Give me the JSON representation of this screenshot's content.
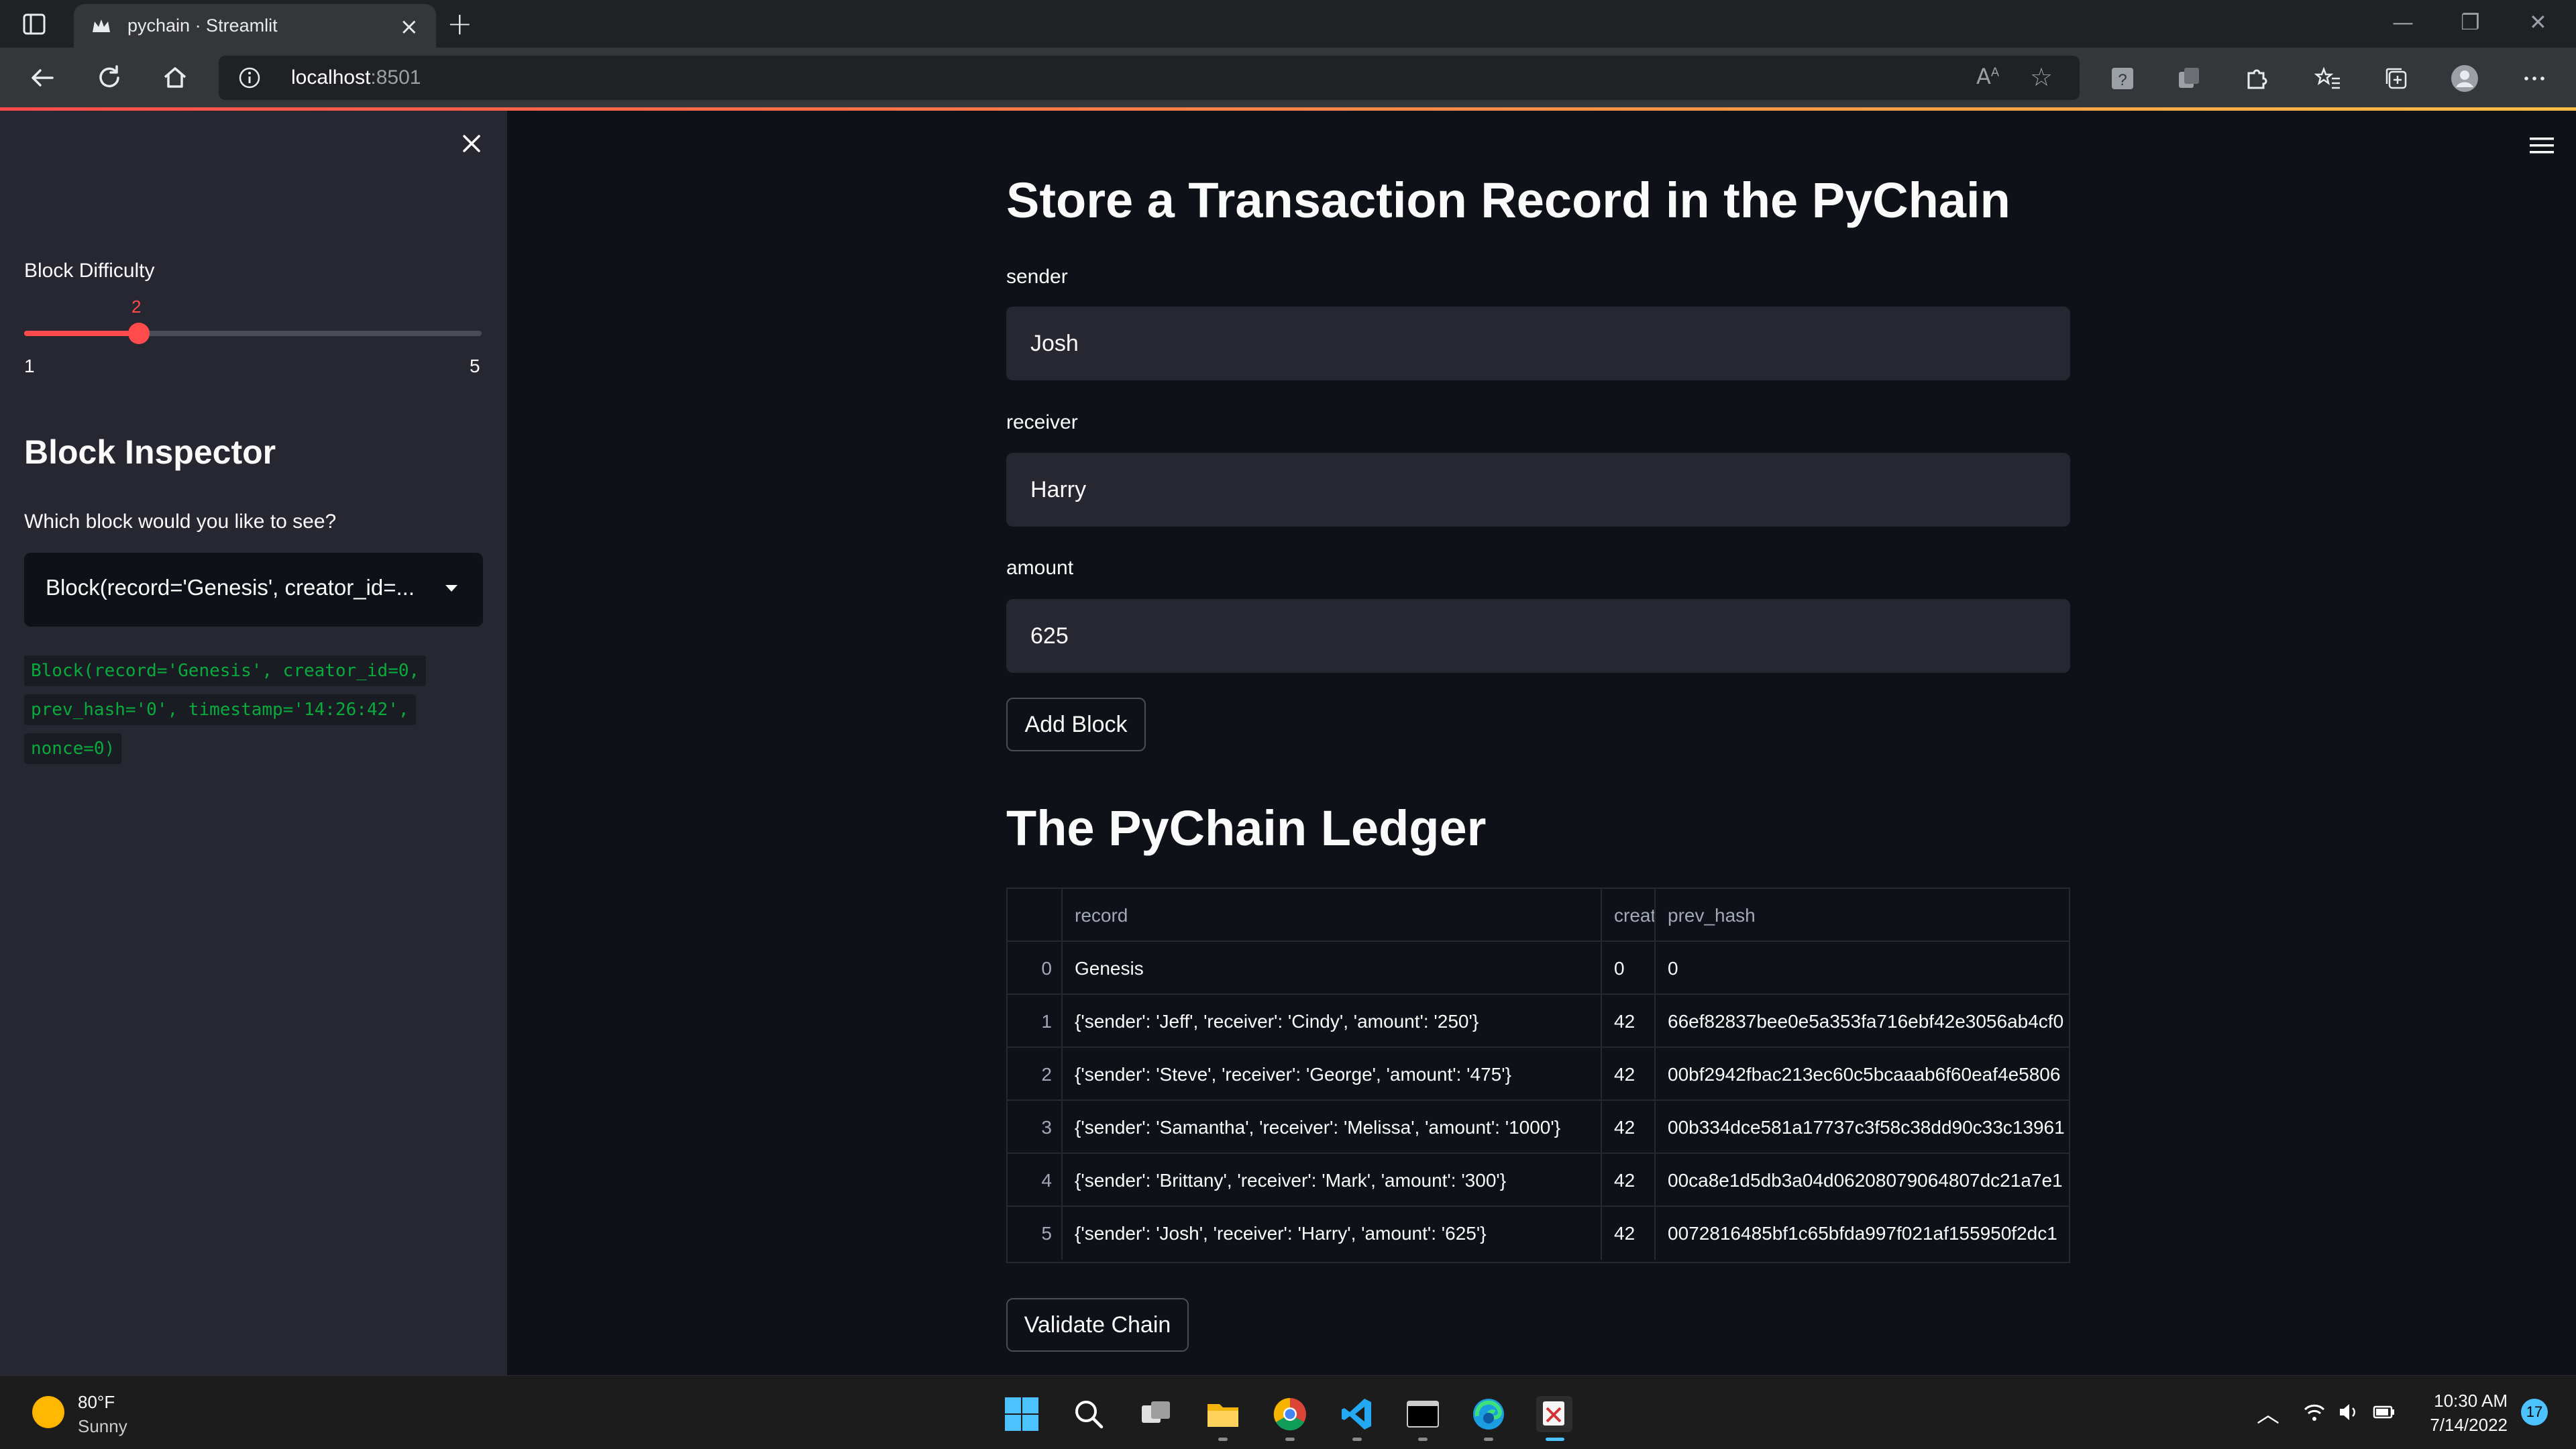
{
  "browser": {
    "tab_title": "pychain · Streamlit",
    "url_host": "localhost",
    "url_port": ":8501"
  },
  "sidebar": {
    "slider_label": "Block Difficulty",
    "slider_value": "2",
    "slider_min": "1",
    "slider_max": "5",
    "slider_fraction": 0.25,
    "inspector_heading": "Block Inspector",
    "select_label": "Which block would you like to see?",
    "select_value": "Block(record='Genesis', creator_id=...",
    "code_lines": [
      "Block(record='Genesis', creator_id=0,",
      "prev_hash='0', timestamp='14:26:42',",
      "nonce=0)"
    ]
  },
  "main": {
    "store_heading": "Store a Transaction Record in the PyChain",
    "sender_label": "sender",
    "sender_value": "Josh",
    "receiver_label": "receiver",
    "receiver_value": "Harry",
    "amount_label": "amount",
    "amount_value": "625",
    "add_block_label": "Add Block",
    "ledger_heading": "The PyChain Ledger",
    "validate_label": "Validate Chain"
  },
  "ledger": {
    "columns": [
      "",
      "record",
      "creat",
      "prev_hash"
    ],
    "rows": [
      [
        "0",
        "Genesis",
        "0",
        "0"
      ],
      [
        "1",
        "{'sender': 'Jeff', 'receiver': 'Cindy', 'amount': '250'}",
        "42",
        "66ef82837bee0e5a353fa716ebf42e3056ab4cf0"
      ],
      [
        "2",
        "{'sender': 'Steve', 'receiver': 'George', 'amount': '475'}",
        "42",
        "00bf2942fbac213ec60c5bcaaab6f60eaf4e5806"
      ],
      [
        "3",
        "{'sender': 'Samantha', 'receiver': 'Melissa', 'amount': '1000'}",
        "42",
        "00b334dce581a17737c3f58c38dd90c33c13961"
      ],
      [
        "4",
        "{'sender': 'Brittany', 'receiver': 'Mark', 'amount': '300'}",
        "42",
        "00ca8e1d5db3a04d06208079064807dc21a7e1"
      ],
      [
        "5",
        "{'sender': 'Josh', 'receiver': 'Harry', 'amount': '625'}",
        "42",
        "0072816485bf1c65bfda997f021af155950f2dc1"
      ]
    ]
  },
  "taskbar": {
    "temperature": "80°F",
    "condition": "Sunny",
    "time": "10:30 AM",
    "date": "7/14/2022",
    "notification_count": "17"
  },
  "colors": {
    "accent": "#ff4b4b",
    "code_green": "#09ab3b",
    "app_bg": "#0e1117",
    "sidebar_bg": "#262730"
  }
}
